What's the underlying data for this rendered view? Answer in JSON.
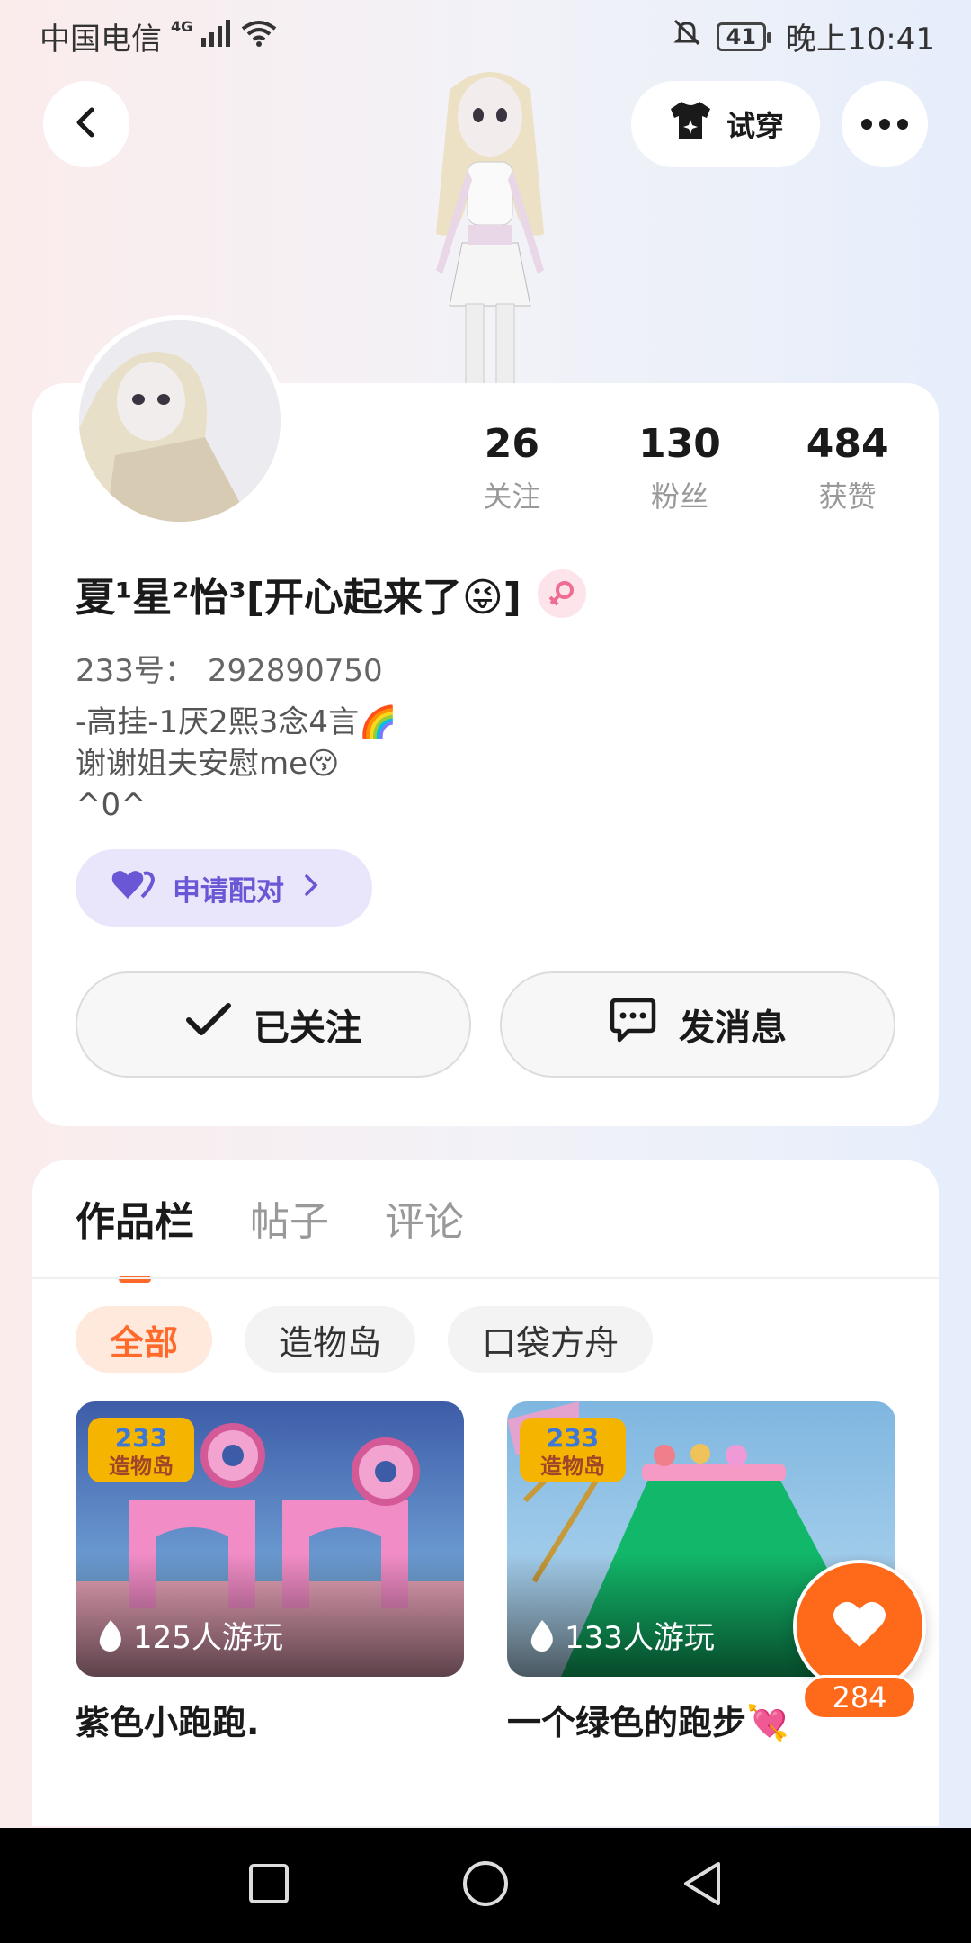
{
  "status_bar": {
    "carrier": "中国电信",
    "network": "4G",
    "battery": "41",
    "time": "晚上10:41"
  },
  "header": {
    "tryon_label": "试穿"
  },
  "profile": {
    "stats": [
      {
        "value": "26",
        "label": "关注"
      },
      {
        "value": "130",
        "label": "粉丝"
      },
      {
        "value": "484",
        "label": "获赞"
      }
    ],
    "username": "夏¹星²怡³[开心起来了😜]",
    "id_label": "233号：",
    "id_value": "292890750",
    "bio_lines": [
      "-高挂-1厌2熙3念4言🌈",
      "谢谢姐夫安慰me😚",
      "^0^"
    ],
    "pair_label": "申请配对",
    "follow_label": "已关注",
    "message_label": "发消息"
  },
  "tabs": [
    "作品栏",
    "帖子",
    "评论"
  ],
  "filters": [
    "全部",
    "造物岛",
    "口袋方舟"
  ],
  "works": [
    {
      "title": "紫色小跑跑.",
      "plays": "125人游玩"
    },
    {
      "title": "一个绿色的跑步💘",
      "plays": "133人游玩"
    }
  ],
  "like_count": "284",
  "colors": {
    "accent": "#ff6a1a",
    "pair_purple": "#6a57d6"
  }
}
